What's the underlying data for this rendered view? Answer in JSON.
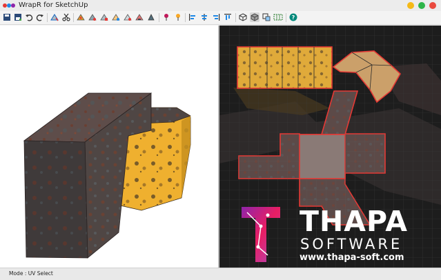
{
  "window": {
    "title": "WrapR for SketchUp",
    "controls": [
      "minimize",
      "zoom",
      "close"
    ]
  },
  "toolbar": {
    "icons": [
      "open-icon",
      "save-icon",
      "undo-icon",
      "redo-icon",
      "select-edges-icon",
      "cut-seam-icon",
      "unwrap-icon",
      "unwrap-planar-icon",
      "unwrap-box-icon",
      "unwrap-cylinder-icon",
      "unwrap-sphere-icon",
      "pin-icon",
      "pin-alt-icon",
      "align-left-icon",
      "align-center-icon",
      "align-right-icon",
      "align-top-icon",
      "cube-outline-icon",
      "cube-solid-icon",
      "uv-map-icon",
      "uv-grid-icon",
      "help-icon"
    ]
  },
  "viewport3d": {
    "label": "3D model viewport"
  },
  "uv_editor": {
    "label": "UV editor"
  },
  "branding": {
    "name": "THAPA",
    "subtitle": "SOFTWARE",
    "url": "www.thapa-soft.com"
  },
  "status": {
    "mode": "Mode : UV Select"
  },
  "colors": {
    "accent_red": "#e53935",
    "rust": "#6b4a3e",
    "yellow": "#f2b93b"
  }
}
